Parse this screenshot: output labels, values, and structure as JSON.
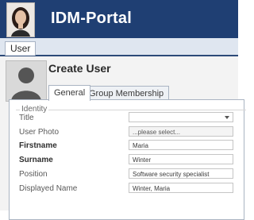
{
  "app": {
    "title": "IDM-Portal"
  },
  "main_tabs": [
    {
      "label": "User"
    }
  ],
  "page": {
    "title": "Create User"
  },
  "tabs": [
    {
      "label": "General"
    },
    {
      "label": "Group Membership"
    }
  ],
  "form": {
    "group_label": "Identity",
    "fields": [
      {
        "label": "Title",
        "value": ""
      },
      {
        "label": "User Photo",
        "value": "...please select..."
      },
      {
        "label": "Firstname",
        "value": "Maria"
      },
      {
        "label": "Surname",
        "value": "Winter"
      },
      {
        "label": "Position",
        "value": "Software security specialist"
      },
      {
        "label": "Displayed Name",
        "value": "Winter, Maria"
      }
    ]
  },
  "icons": {
    "profile_photo": "user-profile-photo-icon",
    "avatar_placeholder": "person-silhouette-icon",
    "dropdown": "chevron-down-icon"
  },
  "colors": {
    "header_bg": "#1f3f73",
    "header_text": "#ffffff",
    "tab_strip_bg": "#dfe6f0",
    "content_bg": "#f3f3f3",
    "panel_border": "#aab4c2"
  }
}
